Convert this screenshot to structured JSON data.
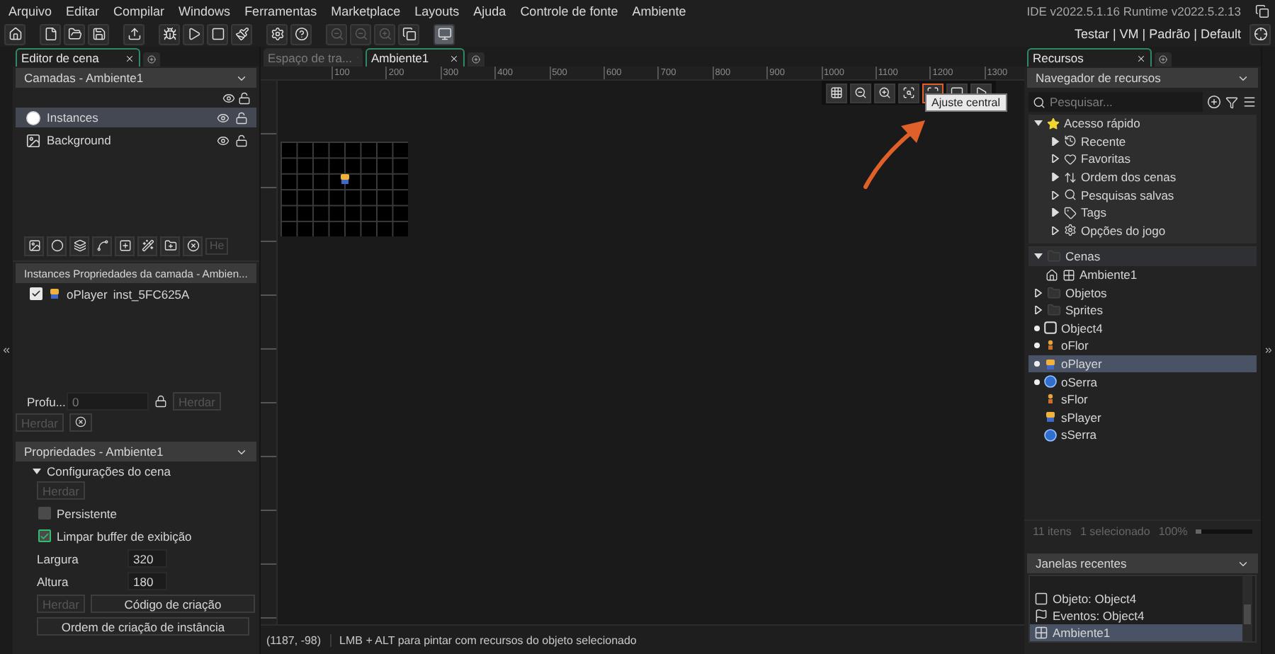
{
  "menu": [
    "Arquivo",
    "Editar",
    "Compilar",
    "Windows",
    "Ferramentas",
    "Marketplace",
    "Layouts",
    "Ajuda",
    "Controle de fonte",
    "Ambiente"
  ],
  "version": "IDE v2022.5.1.16  Runtime v2022.5.2.13",
  "target": "Testar | VM | Padrão | Default",
  "left_tab": {
    "label": "Editor de cena",
    "selected": true
  },
  "layers": {
    "title": "Camadas - Ambiente1",
    "items": [
      {
        "name": "Instances",
        "kind": "instances",
        "selected": true
      },
      {
        "name": "Background",
        "kind": "background",
        "selected": false
      }
    ]
  },
  "layer_tool_field": "He",
  "instances": {
    "title": "Instances Propriedades da camada - Ambien...",
    "items": [
      {
        "name": "oPlayer",
        "instance_name": "inst_5FC625A",
        "checked": true
      }
    ]
  },
  "depth": {
    "label": "Profu...",
    "placeholder": "0",
    "inherit": [
      {
        "label": "Herdar",
        "disabled": true
      },
      {
        "label": "Herdar",
        "disabled": true
      }
    ]
  },
  "properties": {
    "title": "Propriedades - Ambiente1",
    "section": "Configurações do cena",
    "expanded": true,
    "inherit": {
      "label": "Herdar",
      "disabled": true
    },
    "checkboxes": [
      {
        "label": "Persistente",
        "checked": false
      },
      {
        "label": "Limpar buffer de exibição",
        "checked": true
      }
    ],
    "fields": [
      {
        "label": "Largura",
        "value": "320"
      },
      {
        "label": "Altura",
        "value": "180"
      }
    ],
    "inherit2": {
      "label": "Herdar",
      "disabled": true
    },
    "buttons": [
      "Código de criação",
      "Ordem de criação de instância"
    ]
  },
  "center_tabs": [
    {
      "label": "Espaço de tra...",
      "selected": false
    },
    {
      "label": "Ambiente1",
      "selected": true
    }
  ],
  "ruler": [
    "100",
    "200",
    "300",
    "400",
    "500",
    "600",
    "700",
    "800",
    "900",
    "1000",
    "1100",
    "1200",
    "1300"
  ],
  "view_tools": [
    {
      "kind": "grid",
      "highlighted": false
    },
    {
      "kind": "zoom_out",
      "highlighted": false
    },
    {
      "kind": "zoom_in",
      "highlighted": false
    },
    {
      "kind": "zoom_reset",
      "highlighted": false
    },
    {
      "kind": "fit",
      "highlighted": true
    },
    {
      "kind": "screen",
      "highlighted": false
    },
    {
      "kind": "play",
      "highlighted": false
    }
  ],
  "tooltip": "Ajuste central",
  "status": {
    "coords": "(1187, -98)",
    "hint": "LMB + ALT para pintar com recursos do objeto selecionado"
  },
  "right_tab": {
    "label": "Recursos",
    "selected": true
  },
  "browser": {
    "title": "Navegador de recursos",
    "search_placeholder": "Pesquisar...",
    "quick": {
      "label": "Acesso rápido",
      "expanded": true,
      "children": [
        {
          "label": "Recente",
          "kind": "recent"
        },
        {
          "label": "Favoritas",
          "kind": "favorites"
        },
        {
          "label": "Ordem dos cenas",
          "kind": "order"
        },
        {
          "label": "Pesquisas salvas",
          "kind": "searches"
        },
        {
          "label": "Tags",
          "kind": "tags"
        },
        {
          "label": "Opções do jogo",
          "kind": "options"
        }
      ]
    },
    "tree": [
      {
        "label": "Cenas",
        "kind": "folder",
        "expanded": true,
        "selected": false,
        "children": [
          {
            "label": "Ambiente1",
            "kind": "room",
            "selected": false
          }
        ]
      },
      {
        "label": "Objetos",
        "kind": "folder",
        "expanded": false,
        "selected": false
      },
      {
        "label": "Sprites",
        "kind": "folder",
        "expanded": false,
        "selected": false
      },
      {
        "label": "Object4",
        "kind": "object",
        "selected": false
      },
      {
        "label": "oFlor",
        "kind": "object",
        "selected": false
      },
      {
        "label": "oPlayer",
        "kind": "object",
        "selected": true
      },
      {
        "label": "oSerra",
        "kind": "object",
        "selected": false
      },
      {
        "label": "sFlor",
        "kind": "sprite",
        "selected": false
      },
      {
        "label": "sPlayer",
        "kind": "sprite",
        "selected": false
      },
      {
        "label": "sSerra",
        "kind": "sprite",
        "selected": false
      }
    ]
  },
  "footer": {
    "count": "11 itens",
    "selection": "1 selecionado",
    "zoom": "100%",
    "level": 0.1
  },
  "recent": {
    "title": "Janelas recentes",
    "items": [
      {
        "label": "Objeto: Object4",
        "kind": "object",
        "selected": false
      },
      {
        "label": "Eventos: Object4",
        "kind": "events",
        "selected": false
      },
      {
        "label": "Ambiente1",
        "kind": "room",
        "selected": true
      }
    ]
  }
}
